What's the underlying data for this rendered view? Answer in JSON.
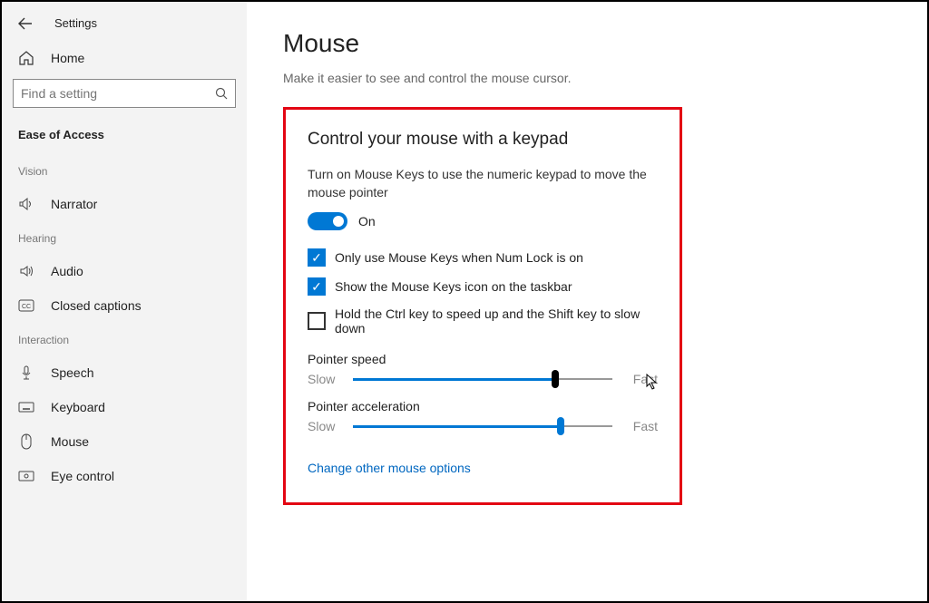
{
  "header": {
    "title": "Settings"
  },
  "sidebar": {
    "home": "Home",
    "search_placeholder": "Find a setting",
    "category": "Ease of Access",
    "groups": [
      {
        "label": "Vision",
        "items": [
          {
            "icon": "narrator-icon",
            "label": "Narrator"
          }
        ]
      },
      {
        "label": "Hearing",
        "items": [
          {
            "icon": "audio-icon",
            "label": "Audio"
          },
          {
            "icon": "cc-icon",
            "label": "Closed captions"
          }
        ]
      },
      {
        "label": "Interaction",
        "items": [
          {
            "icon": "speech-icon",
            "label": "Speech"
          },
          {
            "icon": "keyboard-icon",
            "label": "Keyboard"
          },
          {
            "icon": "mouse-icon",
            "label": "Mouse"
          },
          {
            "icon": "eye-icon",
            "label": "Eye control"
          }
        ]
      }
    ]
  },
  "main": {
    "title": "Mouse",
    "subtitle": "Make it easier to see and control the mouse cursor.",
    "section_title": "Control your mouse with a keypad",
    "desc": "Turn on Mouse Keys to use the numeric keypad to move the mouse pointer",
    "toggle": {
      "state": "On"
    },
    "checks": [
      {
        "checked": true,
        "label": "Only use Mouse Keys when Num Lock is on"
      },
      {
        "checked": true,
        "label": "Show the Mouse Keys icon on the taskbar"
      },
      {
        "checked": false,
        "label": "Hold the Ctrl key to speed up and the Shift key to slow down"
      }
    ],
    "sliders": [
      {
        "title": "Pointer speed",
        "left": "Slow",
        "right": "Fast",
        "pct": 78,
        "handle": "black"
      },
      {
        "title": "Pointer acceleration",
        "left": "Slow",
        "right": "Fast",
        "pct": 80,
        "handle": "blue"
      }
    ],
    "link": "Change other mouse options"
  }
}
